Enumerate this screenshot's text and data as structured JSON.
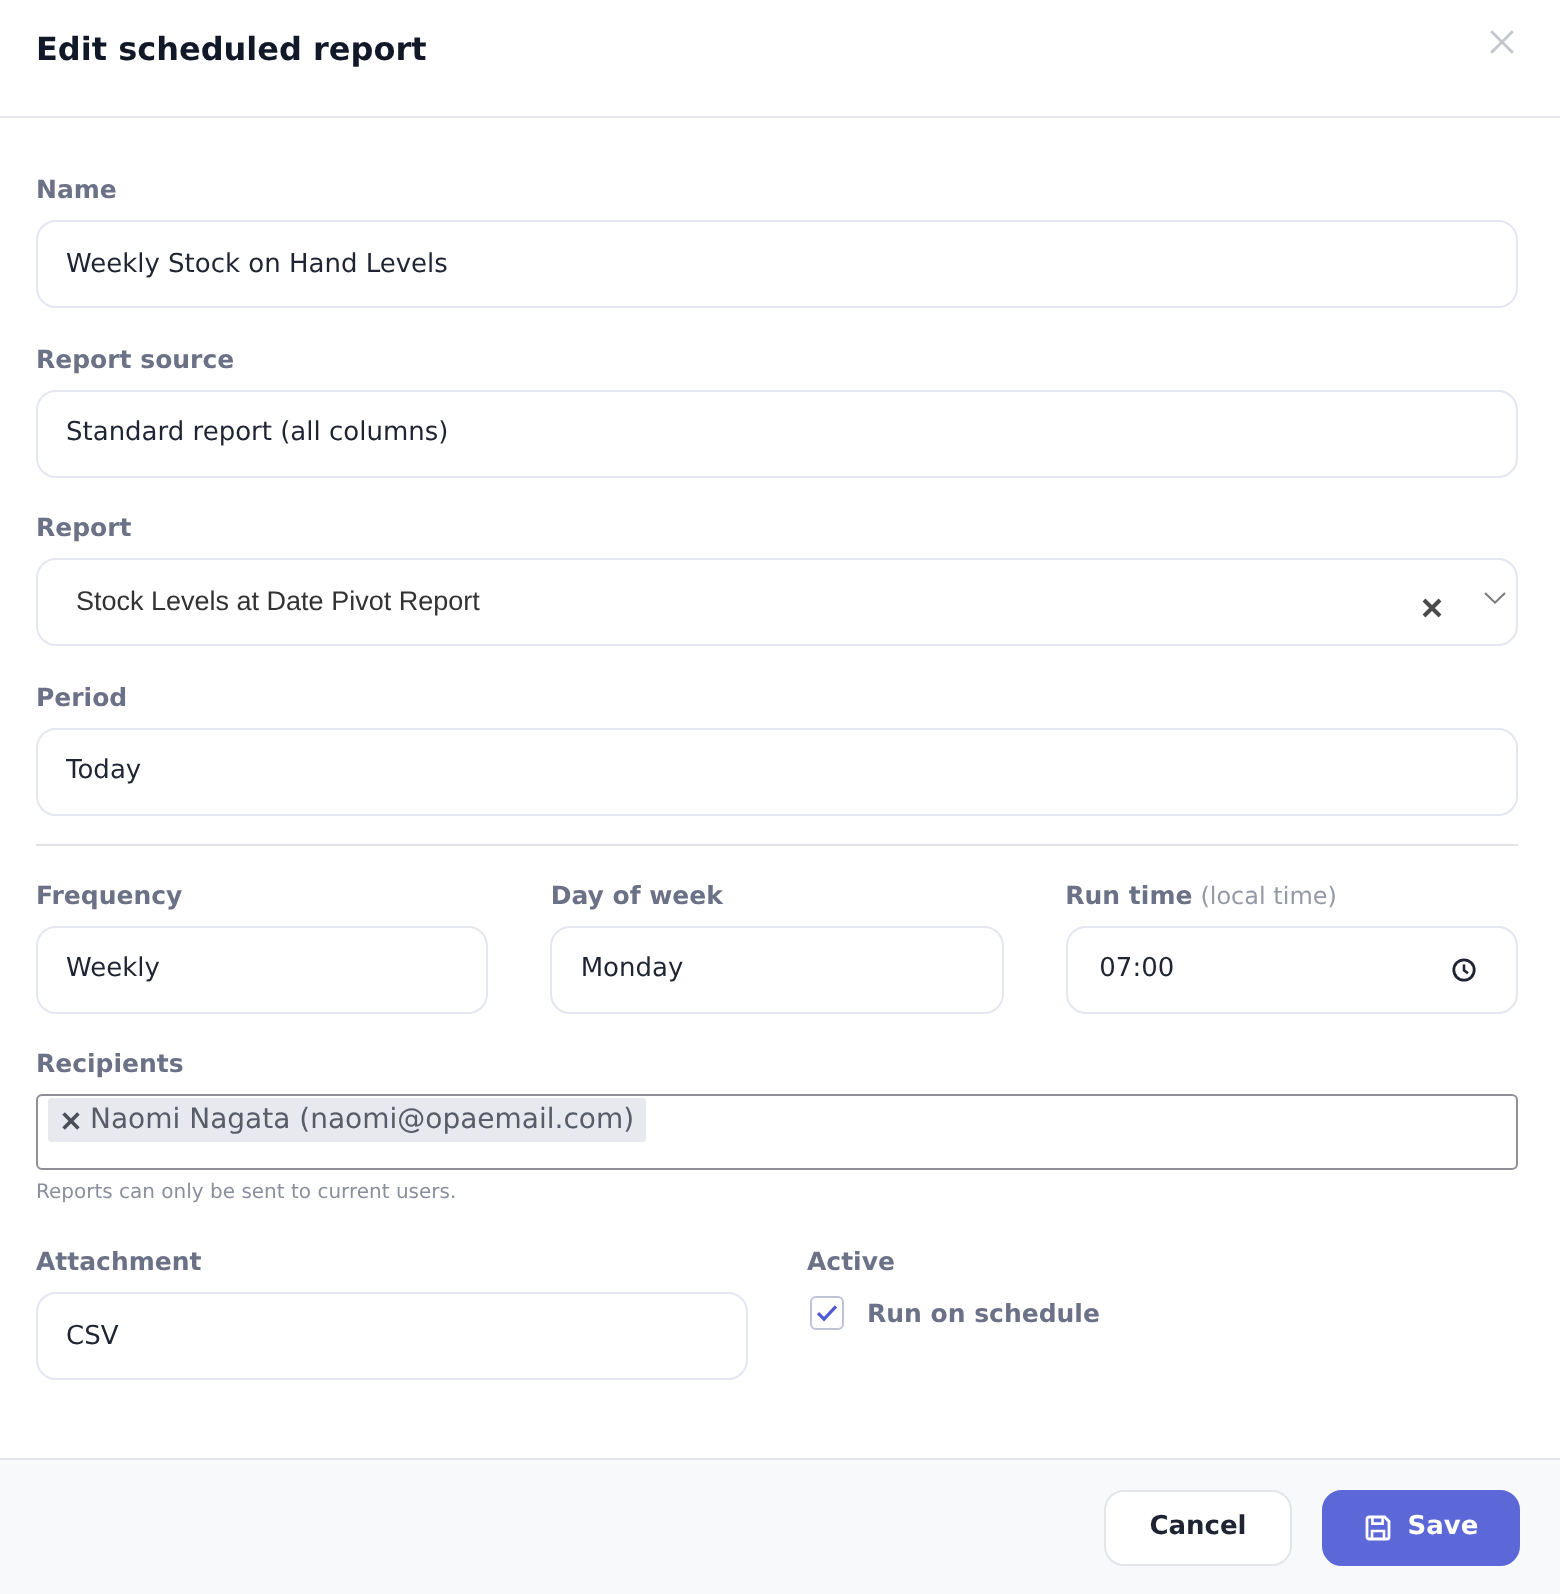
{
  "dialog": {
    "title": "Edit scheduled report"
  },
  "fields": [
    {
      "kind": "text",
      "label": "Name",
      "value": "Weekly Stock on Hand Levels"
    },
    {
      "kind": "text",
      "label": "Report source",
      "value": "Standard report (all columns)"
    },
    {
      "kind": "select",
      "label": "Report",
      "value": "Stock Levels at Date Pivot Report"
    },
    {
      "kind": "text",
      "label": "Period",
      "value": "Today"
    }
  ],
  "schedule": [
    {
      "kind": "text",
      "label": "Frequency",
      "value": "Weekly"
    },
    {
      "kind": "text",
      "label": "Day of week",
      "value": "Monday"
    },
    {
      "kind": "time",
      "label": "Run time",
      "hint": "(local time)",
      "value": "07:00"
    }
  ],
  "recipients": {
    "label": "Recipients",
    "tags": [
      "Naomi Nagata (naomi@opaemail.com)"
    ],
    "help": "Reports can only be sent to current users."
  },
  "attachment": {
    "kind": "text",
    "label": "Attachment",
    "value": "CSV"
  },
  "active": {
    "label": "Active",
    "checkbox": {
      "label": "Run on schedule",
      "checked": true
    }
  },
  "buttons": [
    {
      "kind": "secondary",
      "label": "Cancel"
    },
    {
      "kind": "primary",
      "label": "Save"
    }
  ]
}
